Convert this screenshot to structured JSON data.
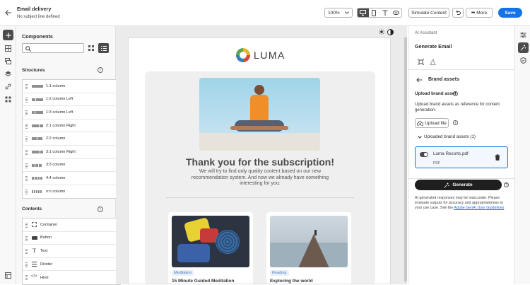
{
  "header": {
    "title": "Email delivery",
    "subtitle": "No subject line defined",
    "zoom": "100%",
    "simulate_label": "Simulate Content",
    "more_label": "More",
    "save_label": "Save"
  },
  "components": {
    "title": "Components",
    "search_placeholder": "",
    "structures_title": "Structures",
    "structures": [
      "1:1 column",
      "1:2 column Left",
      "1:3 column Left",
      "2:1 column Right",
      "2:2 column",
      "3:1 column Right",
      "3:3 column",
      "4:4 column",
      "n:n column"
    ],
    "contents_title": "Contents",
    "contents": [
      "Container",
      "Button",
      "Text",
      "Divider",
      "Html"
    ]
  },
  "email": {
    "brand": "LUMA",
    "heading": "Thank you for the subscription!",
    "body": "We will try to find only quality content based on our new recommendation system. And now we already have something interesting for you:",
    "cards": [
      {
        "tag": "Meditation",
        "title": "15 Minute Guided Meditation"
      },
      {
        "tag": "Reading",
        "title": "Exploring the world"
      }
    ]
  },
  "assistant": {
    "section": "AI Assistant",
    "title": "Generate Email",
    "brand_assets": "Brand assets",
    "upload_title": "Upload brand asset",
    "upload_desc": "Upload brand assets as reference for content generation.",
    "upload_btn": "Upload file",
    "uploaded_label": "Uploaded brand assets (1)",
    "file_name": "Luma Resorts.pdf",
    "file_type": "PDF",
    "generate_label": "Generate",
    "disclaimer": "AI generated responses may be inaccurate. Please evaluate outputs for accuracy and appropriateness to your use case. See the",
    "guidelines_link": "Adobe GenAI User Guidelines",
    "accent": "#1473e6"
  }
}
